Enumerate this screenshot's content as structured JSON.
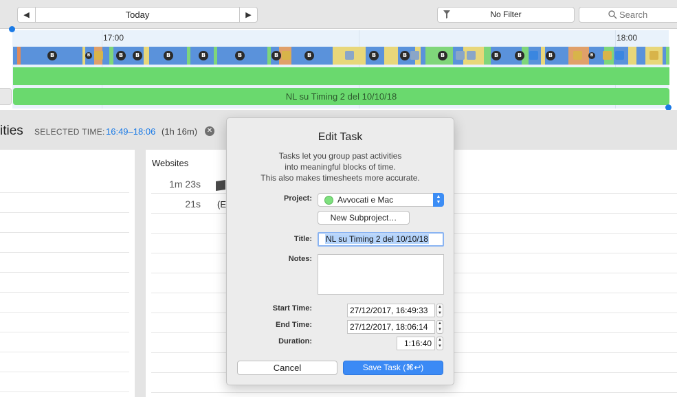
{
  "toolbar": {
    "prev_icon": "chevron-left-icon",
    "today_label": "Today",
    "next_icon": "chevron-right-icon",
    "filter_label": "No Filter",
    "search_placeholder": "Search"
  },
  "timeline": {
    "tick_labels": [
      "17:00",
      "18:00"
    ],
    "task_label": "NL su Timing 2 del 10/10/18",
    "project_color": "#6ad96e",
    "activity_color": "#5a92db"
  },
  "summary": {
    "heading": "ities",
    "selected_label": "SELECTED TIME:",
    "selected_range": "16:49–18:06",
    "selected_duration": "(1h 16m)",
    "clear_icon": "close-circle-icon"
  },
  "websites": {
    "title": "Websites",
    "rows": [
      {
        "duration": "1m 23s",
        "label": ""
      },
      {
        "duration": "21s",
        "label": "(E"
      }
    ]
  },
  "dialog": {
    "title": "Edit Task",
    "description": [
      "Tasks let you group past activities",
      "into meaningful blocks of time.",
      "This also makes timesheets more accurate."
    ],
    "project_label": "Project:",
    "project_value": "Avvocati e Mac",
    "project_color": "#7ee07e",
    "new_subproject_label": "New Subproject…",
    "title_label": "Title:",
    "title_value": "NL su Timing 2 del 10/10/18",
    "notes_label": "Notes:",
    "notes_value": "",
    "start_label": "Start Time:",
    "start_value": "27/12/2017, 16:49:33",
    "end_label": "End Time:",
    "end_value": "27/12/2017, 18:06:14",
    "duration_label": "Duration:",
    "duration_value": "1:16:40",
    "cancel_label": "Cancel",
    "save_label": "Save Task (⌘↩)"
  }
}
